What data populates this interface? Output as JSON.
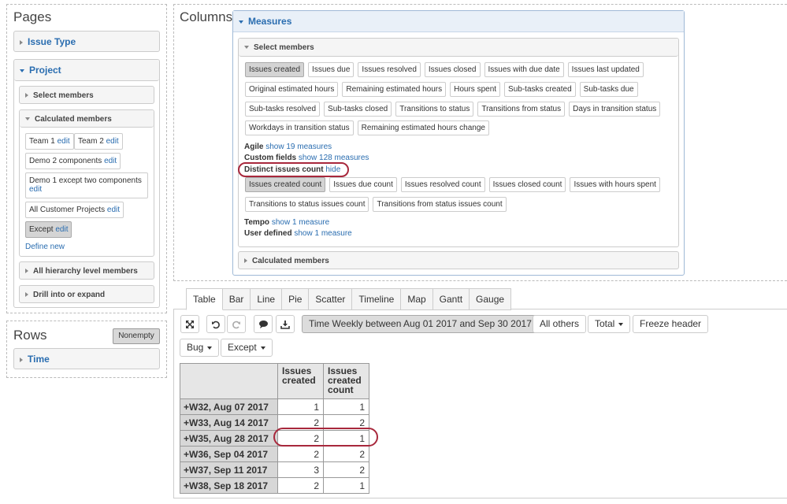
{
  "pages": {
    "title": "Pages",
    "issue_type": "Issue Type",
    "project": "Project",
    "select_members": "Select members",
    "calculated_members": "Calculated members",
    "members": [
      {
        "name": "Team 1",
        "edit": "edit"
      },
      {
        "name": "Team 2",
        "edit": "edit"
      },
      {
        "name": "Demo 2 components",
        "edit": "edit"
      },
      {
        "name": "Demo 1 except two components",
        "edit": "edit"
      },
      {
        "name": "All Customer Projects",
        "edit": "edit"
      },
      {
        "name": "Except",
        "edit": "edit"
      }
    ],
    "define_new": "Define new",
    "all_hierarchy": "All hierarchy level members",
    "drill": "Drill into or expand"
  },
  "rows": {
    "title": "Rows",
    "nonempty": "Nonempty",
    "time": "Time"
  },
  "columns": {
    "title": "Columns",
    "measures": "Measures",
    "select_members": "Select members",
    "measure_rows": [
      [
        "Issues created",
        "Issues due",
        "Issues resolved",
        "Issues closed",
        "Issues with due date",
        "Issues last updated"
      ],
      [
        "Original estimated hours",
        "Remaining estimated hours",
        "Hours spent",
        "Sub-tasks created",
        "Sub-tasks due"
      ],
      [
        "Sub-tasks resolved",
        "Sub-tasks closed",
        "Transitions to status",
        "Transitions from status",
        "Days in transition status"
      ],
      [
        "Workdays in transition status",
        "Remaining estimated hours change"
      ]
    ],
    "agile_label": "Agile",
    "agile_link": "show 19 measures",
    "custom_label": "Custom fields",
    "custom_link": "show 128 measures",
    "distinct_label": "Distinct issues count",
    "distinct_link": "hide",
    "distinct_rows": [
      [
        "Issues created count",
        "Issues due count",
        "Issues resolved count",
        "Issues closed count",
        "Issues with hours spent"
      ],
      [
        "Transitions to status issues count",
        "Transitions from status issues count"
      ]
    ],
    "tempo_label": "Tempo",
    "tempo_link": "show 1 measure",
    "user_label": "User defined",
    "user_link": "show 1 measure",
    "calculated_members": "Calculated members"
  },
  "tabs": [
    "Table",
    "Bar",
    "Line",
    "Pie",
    "Scatter",
    "Timeline",
    "Map",
    "Gantt",
    "Gauge"
  ],
  "toolbar": {
    "time_filter": "Time Weekly between Aug 01 2017 and Sep 30 2017",
    "all_others": "All others",
    "total": "Total",
    "freeze": "Freeze header",
    "bug": "Bug",
    "except": "Except"
  },
  "table": {
    "headers": [
      "Issues created",
      "Issues created count"
    ],
    "rows": [
      {
        "label": "W32, Aug 07 2017",
        "values": [
          "1",
          "1"
        ]
      },
      {
        "label": "W33, Aug 14 2017",
        "values": [
          "2",
          "2"
        ]
      },
      {
        "label": "W35, Aug 28 2017",
        "values": [
          "2",
          "1"
        ]
      },
      {
        "label": "W36, Sep 04 2017",
        "values": [
          "2",
          "2"
        ]
      },
      {
        "label": "W37, Sep 11 2017",
        "values": [
          "3",
          "2"
        ]
      },
      {
        "label": "W38, Sep 18 2017",
        "values": [
          "2",
          "1"
        ]
      }
    ]
  },
  "colors": {
    "link": "#2a6db0",
    "highlight_oval": "#a8283c",
    "selected_button": "#d4d4d4",
    "row_header": "#d7d7d7"
  }
}
